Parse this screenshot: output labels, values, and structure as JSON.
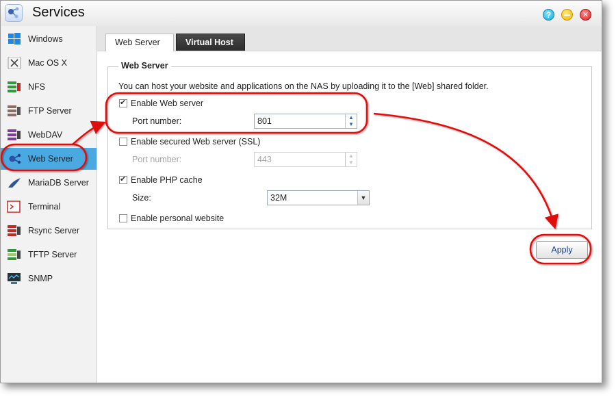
{
  "window": {
    "title": "Services"
  },
  "sidebar": {
    "items": [
      {
        "label": "Windows",
        "icon": "windows-icon"
      },
      {
        "label": "Mac OS X",
        "icon": "mac-os-x-icon"
      },
      {
        "label": "NFS",
        "icon": "nfs-icon"
      },
      {
        "label": "FTP Server",
        "icon": "ftp-server-icon"
      },
      {
        "label": "WebDAV",
        "icon": "webdav-icon"
      },
      {
        "label": "Web Server",
        "icon": "web-server-icon",
        "active": true
      },
      {
        "label": "MariaDB Server",
        "icon": "mariadb-icon"
      },
      {
        "label": "Terminal",
        "icon": "terminal-icon"
      },
      {
        "label": "Rsync Server",
        "icon": "rsync-server-icon"
      },
      {
        "label": "TFTP Server",
        "icon": "tftp-server-icon"
      },
      {
        "label": "SNMP",
        "icon": "snmp-icon"
      }
    ]
  },
  "tabs": [
    {
      "label": "Web Server",
      "active": true
    },
    {
      "label": "Virtual Host",
      "active": false
    }
  ],
  "web_server": {
    "legend": "Web Server",
    "description": "You can host your website and applications on the NAS by uploading it to the [Web] shared folder.",
    "enable_web_server": {
      "label": "Enable Web server",
      "checked": true
    },
    "port": {
      "label": "Port number:",
      "value": "801"
    },
    "enable_ssl": {
      "label": "Enable secured Web server (SSL)",
      "checked": false
    },
    "ssl_port": {
      "label": "Port number:",
      "value": "443",
      "disabled": true
    },
    "enable_php_cache": {
      "label": "Enable PHP cache",
      "checked": true
    },
    "size": {
      "label": "Size:",
      "value": "32M"
    },
    "enable_personal_website": {
      "label": "Enable personal website",
      "checked": false
    }
  },
  "apply_label": "Apply",
  "colors": {
    "sidebar_active": "#4aa9e0",
    "annotation_red": "#e01010"
  }
}
